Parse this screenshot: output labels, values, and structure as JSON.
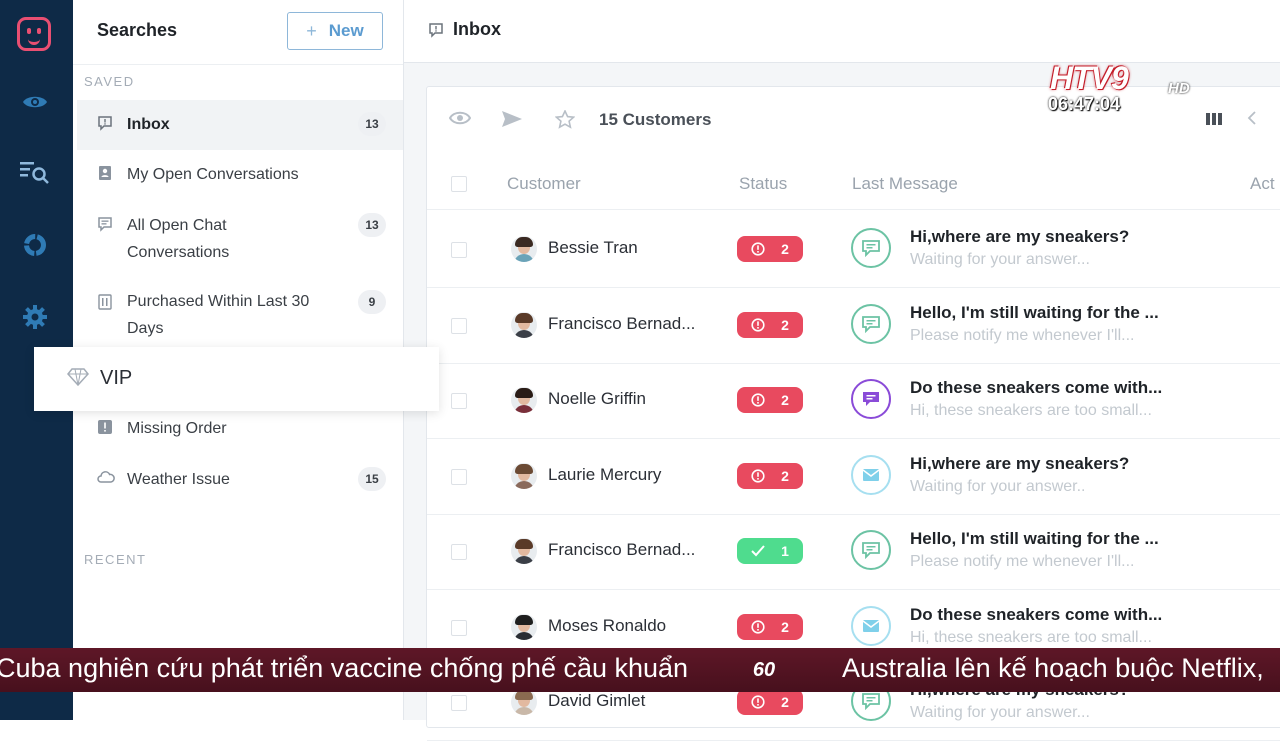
{
  "sidebar": {
    "title": "Searches",
    "new_button": "New",
    "saved_label": "SAVED",
    "recent_label": "RECENT",
    "items": [
      {
        "label": "Inbox",
        "count": "13"
      },
      {
        "label": "My Open Conversations",
        "count": ""
      },
      {
        "label": "All Open Chat Conversations",
        "count": "13"
      },
      {
        "label": "Purchased Within Last 30 Days",
        "count": "9"
      },
      {
        "label": "VIP",
        "count": ""
      },
      {
        "label": "Missing Order",
        "count": ""
      },
      {
        "label": "Weather Issue",
        "count": "15"
      }
    ]
  },
  "header": {
    "title": "Inbox"
  },
  "list": {
    "count_title": "15 Customers",
    "columns": [
      "Customer",
      "Status",
      "Last Message",
      "Act"
    ],
    "rows": [
      {
        "name": "Bessie Tran",
        "status": "2",
        "status_type": "open",
        "channel": "chat",
        "title": "Hi,where are my sneakers?",
        "preview": "Waiting for your answer..."
      },
      {
        "name": "Francisco Bernad...",
        "status": "2",
        "status_type": "open",
        "channel": "chat",
        "title": "Hello, I'm still waiting for the ...",
        "preview": "Please notify me whenever I'll..."
      },
      {
        "name": "Noelle Griffin",
        "status": "2",
        "status_type": "open",
        "channel": "messenger",
        "title": "Do these sneakers come with...",
        "preview": "Hi, these sneakers are too small..."
      },
      {
        "name": "Laurie Mercury",
        "status": "2",
        "status_type": "open",
        "channel": "email",
        "title": "Hi,where are my sneakers?",
        "preview": "Waiting for your answer.."
      },
      {
        "name": "Francisco Bernad...",
        "status": "1",
        "status_type": "done",
        "channel": "chat",
        "title": "Hello, I'm still waiting for the ...",
        "preview": "Please notify me whenever I'll..."
      },
      {
        "name": "Moses Ronaldo",
        "status": "2",
        "status_type": "open",
        "channel": "email",
        "title": "Do these sneakers come with...",
        "preview": "Hi, these sneakers are too small..."
      },
      {
        "name": "David Gimlet",
        "status": "2",
        "status_type": "open",
        "channel": "chat",
        "title": "Hi,where are my sneakers?",
        "preview": "Waiting for your answer..."
      }
    ]
  },
  "overlay": {
    "channel_logo": "HTV9",
    "channel_hd": "HD",
    "clock": "06:47:04",
    "ticker_left": "Cuba nghiên cứu phát triển vaccine chống phế cầu khuẩn",
    "ticker_sep": "60",
    "ticker_right": "Australia lên kế hoạch buộc Netflix,"
  },
  "colors": {
    "rail": "#0e2a47",
    "accent": "#e94f72",
    "status_open": "#e84a5f",
    "status_done": "#4fdc8e"
  }
}
